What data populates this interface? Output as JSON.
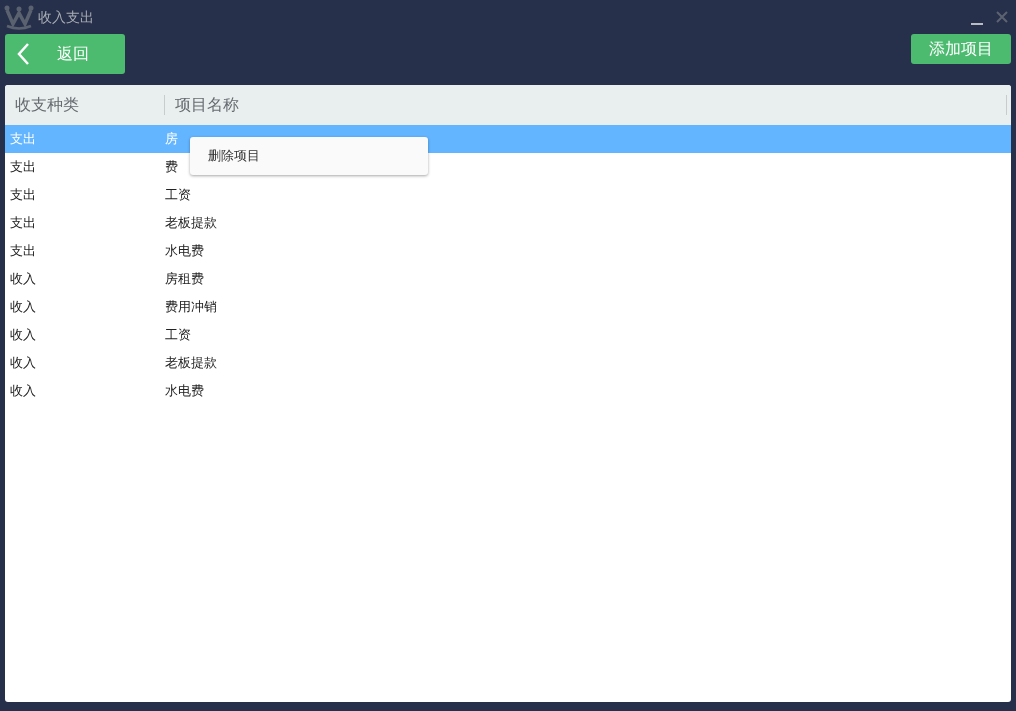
{
  "window": {
    "title": "收入支出"
  },
  "toolbar": {
    "back": "返回",
    "add": "添加项目"
  },
  "table": {
    "columns": [
      "收支种类",
      "项目名称"
    ],
    "rows": [
      {
        "type": "支出",
        "name": "房",
        "selected": true
      },
      {
        "type": "支出",
        "name": "费",
        "selected": false
      },
      {
        "type": "支出",
        "name": "工资",
        "selected": false
      },
      {
        "type": "支出",
        "name": "老板提款",
        "selected": false
      },
      {
        "type": "支出",
        "name": "水电费",
        "selected": false
      },
      {
        "type": "收入",
        "name": "房租费",
        "selected": false
      },
      {
        "type": "收入",
        "name": "费用冲销",
        "selected": false
      },
      {
        "type": "收入",
        "name": "工资",
        "selected": false
      },
      {
        "type": "收入",
        "name": "老板提款",
        "selected": false
      },
      {
        "type": "收入",
        "name": "水电费",
        "selected": false
      }
    ]
  },
  "context_menu": {
    "items": [
      "删除项目"
    ]
  }
}
